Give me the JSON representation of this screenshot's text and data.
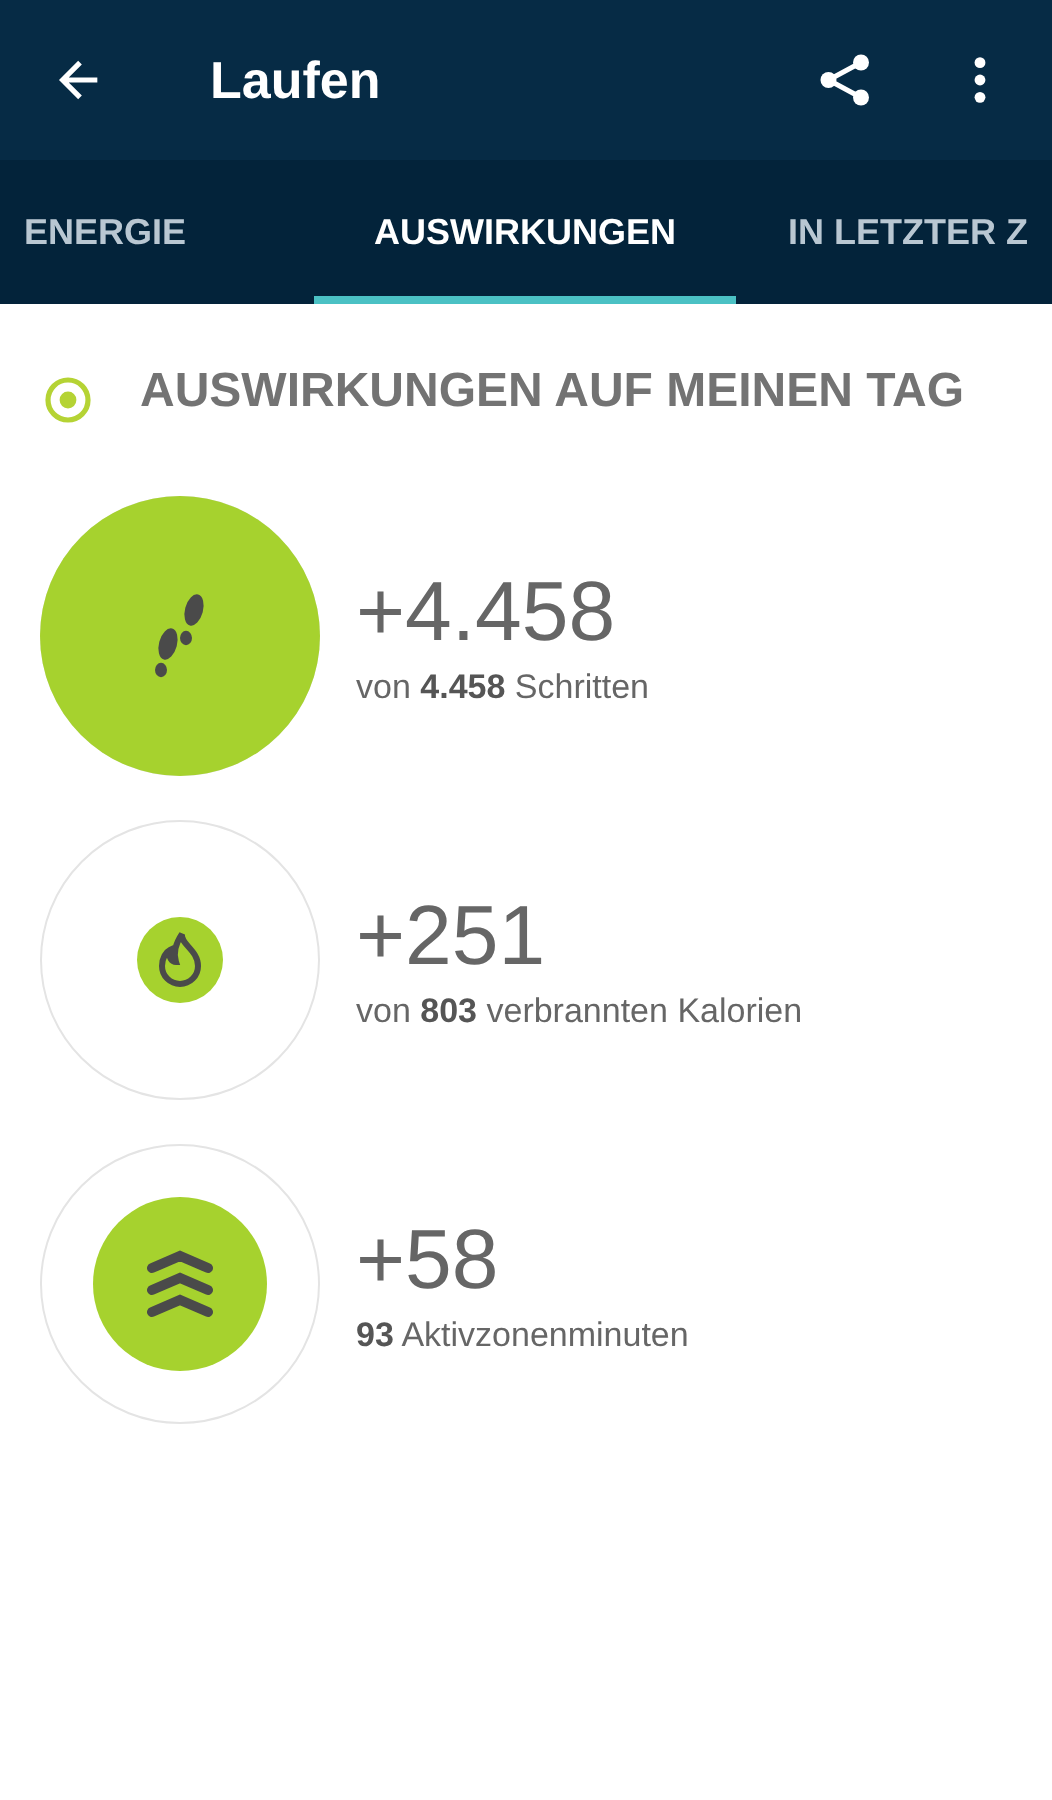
{
  "app_bar": {
    "title": "Laufen"
  },
  "tabs": [
    {
      "label": "ENERGIE",
      "selected": false
    },
    {
      "label": "AUSWIRKUNGEN",
      "selected": true
    },
    {
      "label": "IN LETZTER Z",
      "selected": false
    }
  ],
  "section": {
    "title": "AUSWIRKUNGEN AUF MEINEN TAG"
  },
  "stats": [
    {
      "kind": "steps",
      "value": "+4.458",
      "caption": "von **4.458** Schritten"
    },
    {
      "kind": "calories",
      "value": "+251",
      "caption": "von **803** verbrannten Kalorien"
    },
    {
      "kind": "zone",
      "value": "+58",
      "caption": "**93** Aktivzonenminuten"
    }
  ]
}
